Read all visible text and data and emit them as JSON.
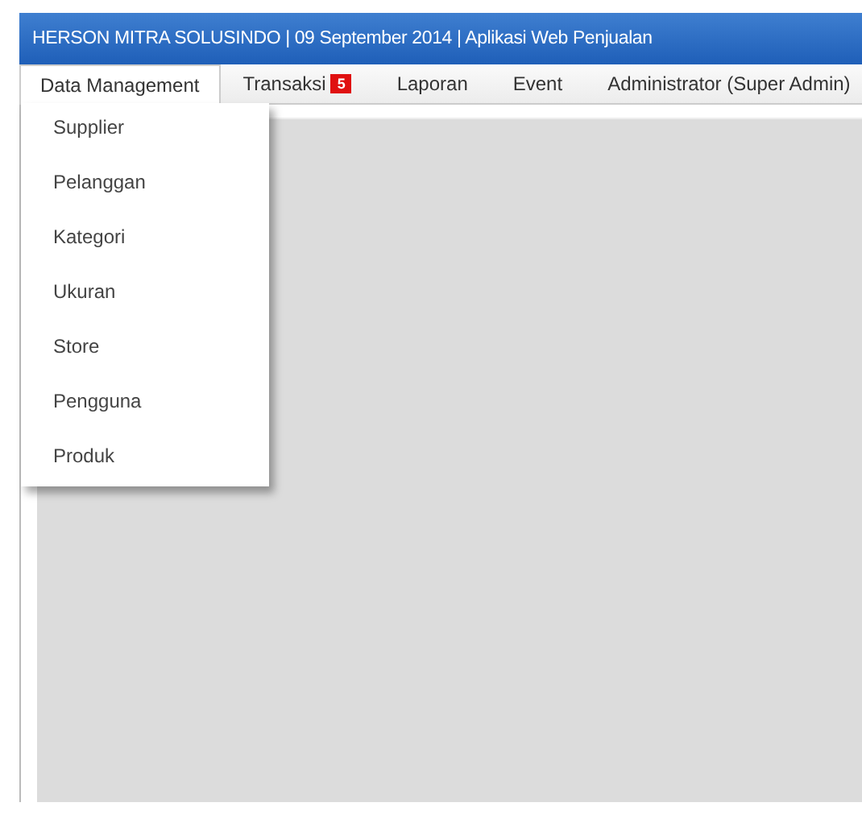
{
  "header": {
    "title": "HERSON MITRA SOLUSINDO | 09 September 2014 | Aplikasi Web Penjualan"
  },
  "menu": [
    {
      "label": "Data Management",
      "selected": true
    },
    {
      "label": "Transaksi",
      "selected": false,
      "badge": "5"
    },
    {
      "label": "Laporan",
      "selected": false
    },
    {
      "label": "Event",
      "selected": false
    },
    {
      "label": "Administrator (Super Admin)",
      "selected": false
    }
  ],
  "dropdown": {
    "items": [
      "Supplier",
      "Pelanggan",
      "Kategori",
      "Ukuran",
      "Store",
      "Pengguna",
      "Produk"
    ]
  }
}
